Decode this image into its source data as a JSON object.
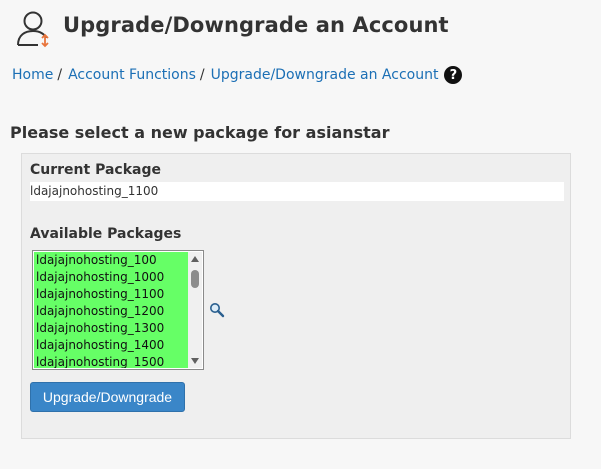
{
  "header": {
    "icon": "user-switch-icon",
    "title": "Upgrade/Downgrade an Account"
  },
  "breadcrumb": {
    "items": [
      {
        "label": "Home"
      },
      {
        "label": "Account Functions"
      },
      {
        "label": "Upgrade/Downgrade an Account"
      }
    ],
    "separator": "/",
    "help_icon": "question-circle-icon",
    "help_glyph": "?"
  },
  "form": {
    "heading": "Please select a new package for asianstar",
    "current_package_label": "Current Package",
    "current_package_value": "ldajajnohosting_1100",
    "available_packages_label": "Available Packages",
    "available_packages": [
      "ldajajnohosting_100",
      "ldajajnohosting_1000",
      "ldajajnohosting_1100",
      "ldajajnohosting_1200",
      "ldajajnohosting_1300",
      "ldajajnohosting_1400",
      "ldajajnohosting_1500"
    ],
    "search_icon": "magnifier-icon",
    "submit_label": "Upgrade/Downgrade"
  },
  "colors": {
    "link": "#1b6fb5",
    "list_highlight": "#66ff66",
    "button": "#3a86c8",
    "background": "#f7f7f7"
  }
}
